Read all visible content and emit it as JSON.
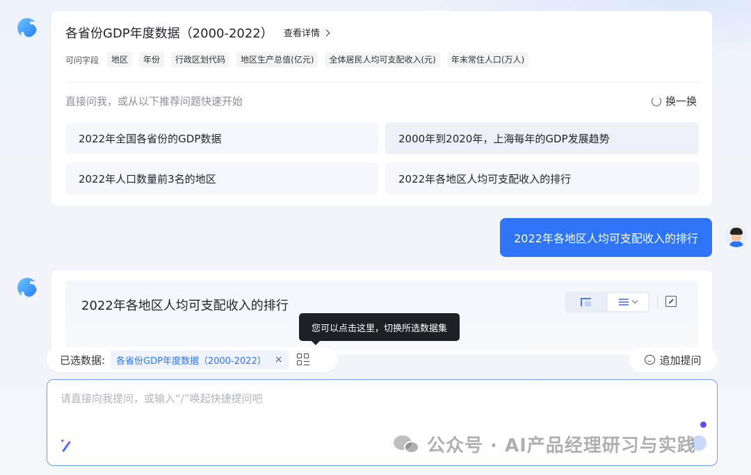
{
  "dataset": {
    "title": "各省份GDP年度数据（2000-2022）",
    "detail_link": "查看详情",
    "fields_label": "可问字段",
    "fields": [
      "地区",
      "年份",
      "行政区划代码",
      "地区生产总值(亿元)",
      "全体居民人均可支配收入(元)",
      "年末常住人口(万人)"
    ],
    "ask_hint": "直接问我，或从以下推荐问题快速开始",
    "refresh_label": "换一换",
    "questions": [
      "2022年全国各省份的GDP数据",
      "2000年到2020年，上海每年的GDP发展趋势",
      "2022年人口数量前3名的地区",
      "2022年各地区人均可支配收入的排行"
    ]
  },
  "user_message": "2022年各地区人均可支配收入的排行",
  "answer": {
    "title": "2022年各地区人均可支配收入的排行"
  },
  "tooltip": "您可以点击这里，切换所选数据集",
  "selected": {
    "label": "已选数据:",
    "tag": "各省份GDP年度数据（2000-2022）",
    "close": "×"
  },
  "followup_label": "追加提问",
  "input": {
    "placeholder": "请直接向我提问，或输入“/”唤起快捷提问吧"
  },
  "watermark": "公众号 · AI产品经理研习与实践"
}
